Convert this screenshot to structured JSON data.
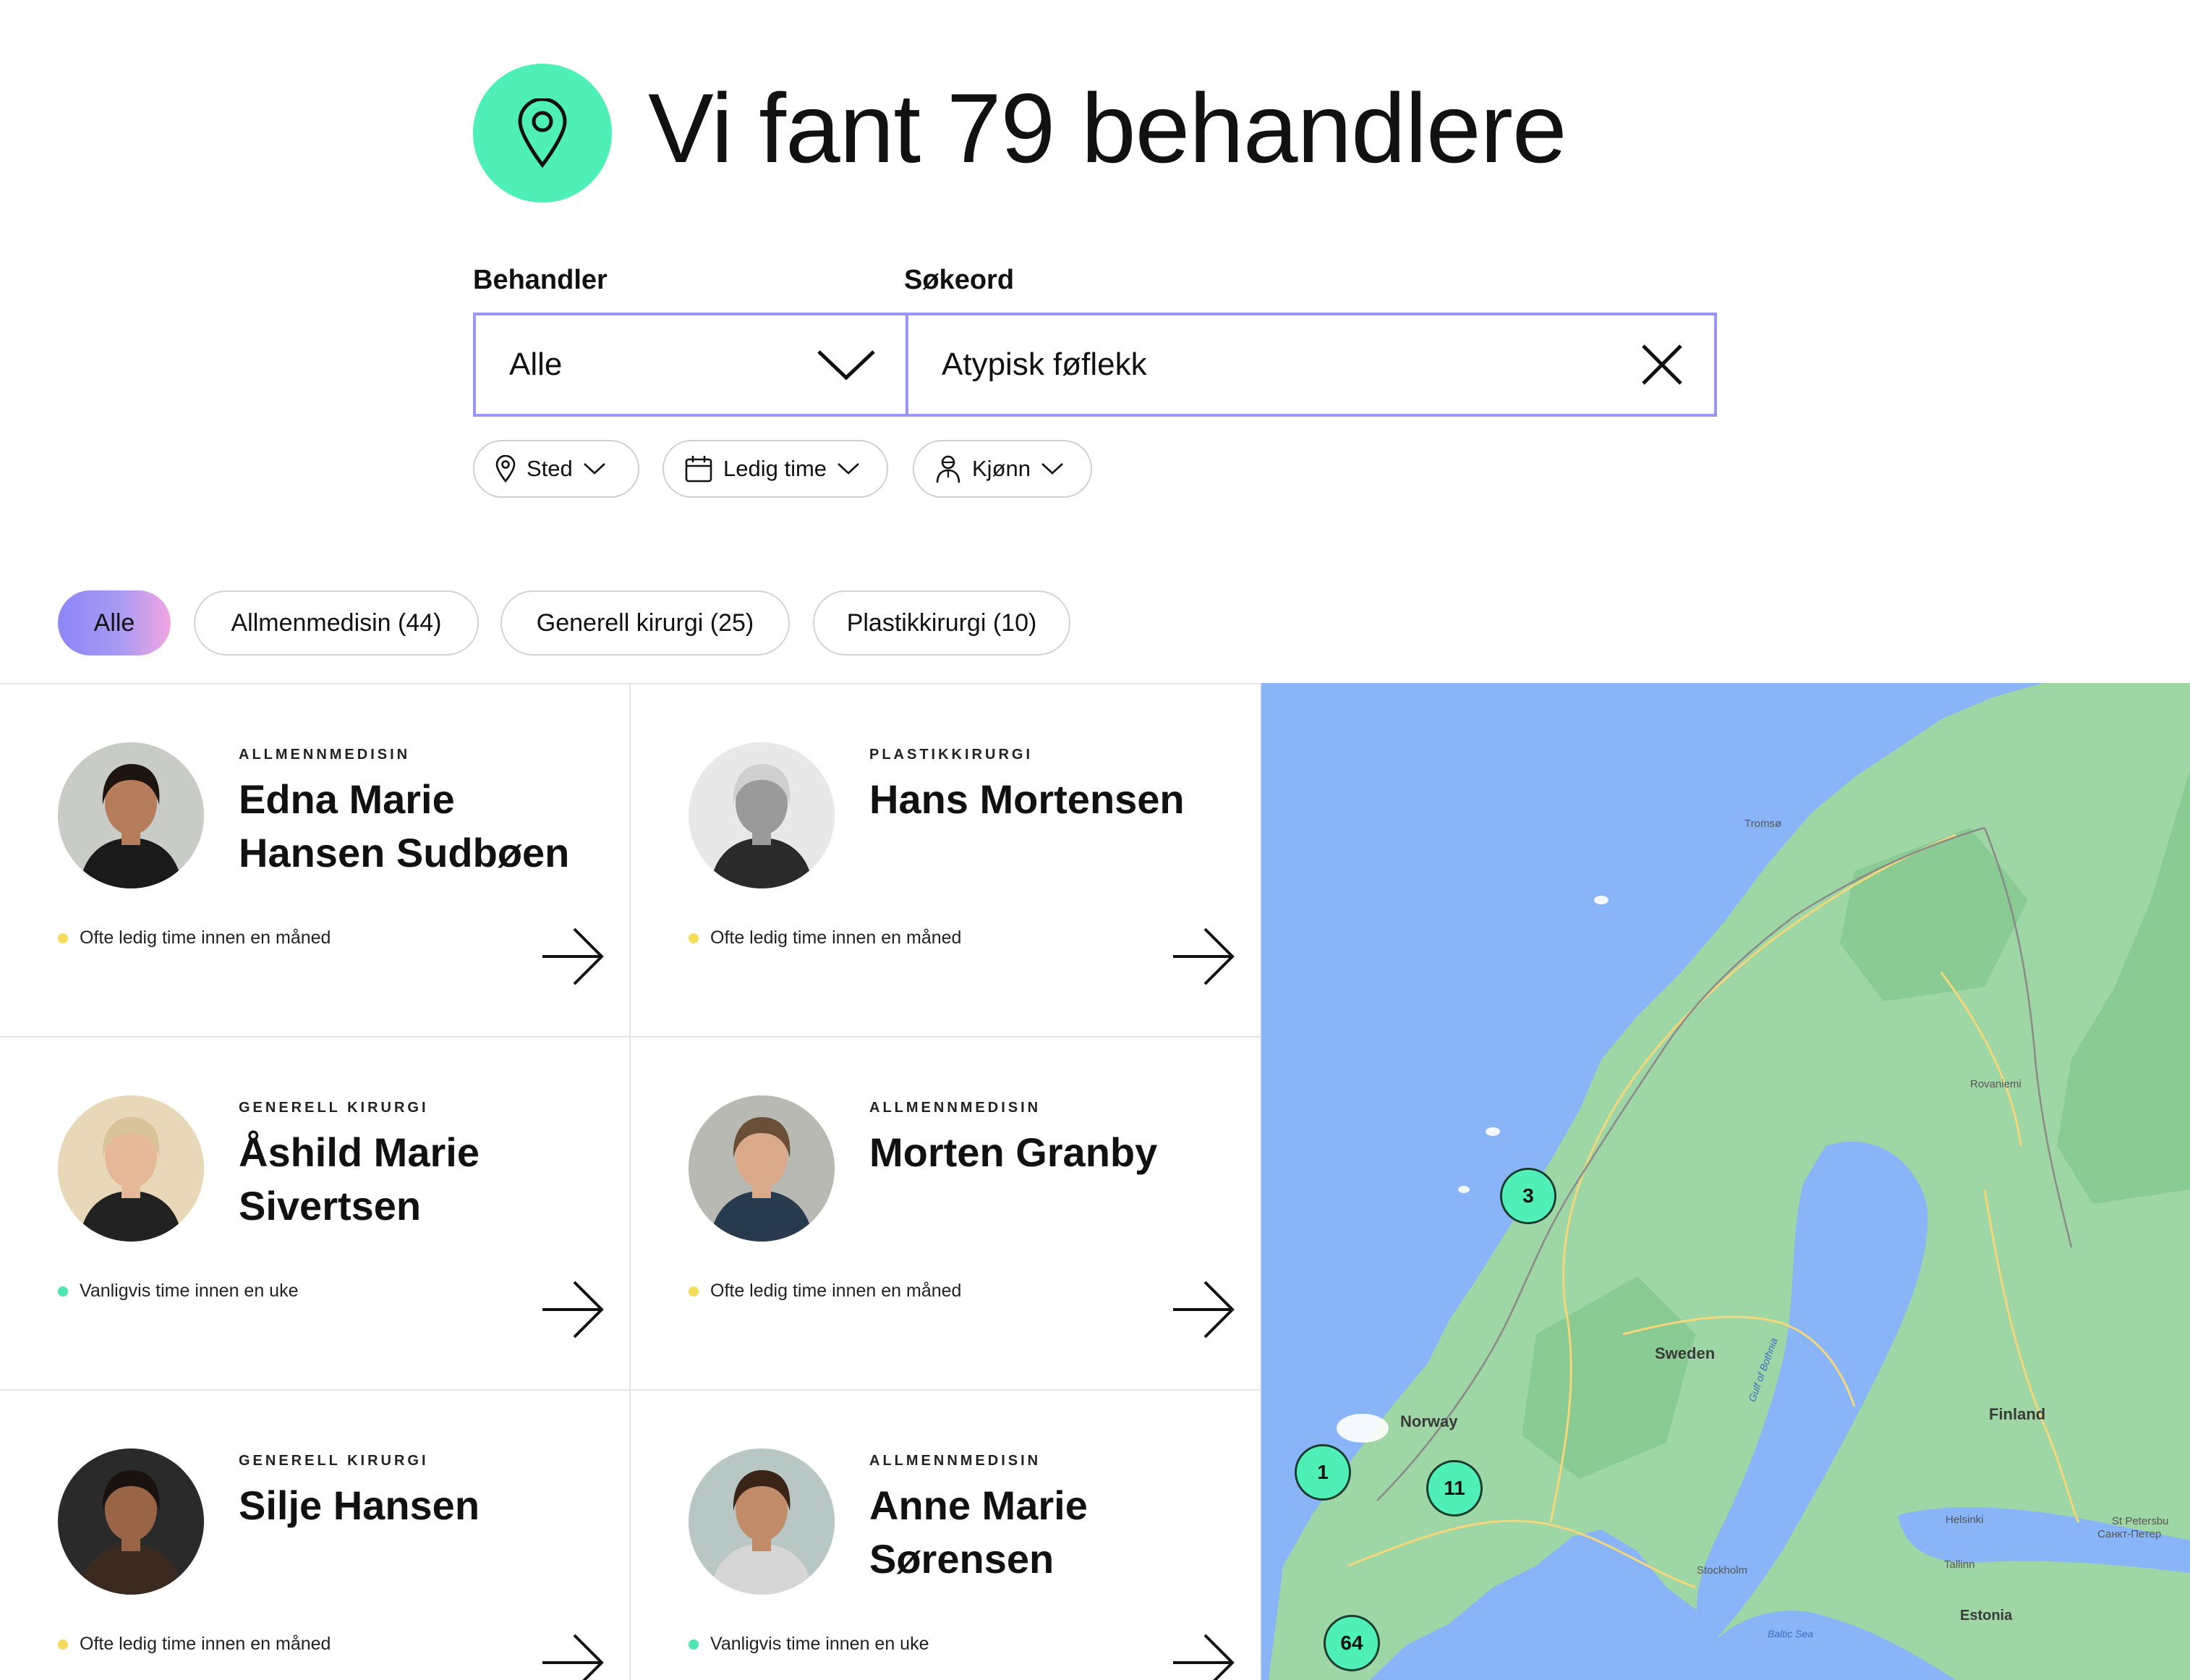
{
  "header": {
    "title": "Vi fant 79 behandlere"
  },
  "search": {
    "behandler_label": "Behandler",
    "behandler_value": "Alle",
    "sokeord_label": "Søkeord",
    "sokeord_value": "Atypisk føflekk"
  },
  "filters": [
    {
      "label": "Sted",
      "icon": "location-pin-icon"
    },
    {
      "label": "Ledig time",
      "icon": "calendar-icon"
    },
    {
      "label": "Kjønn",
      "icon": "person-icon"
    }
  ],
  "tabs": [
    {
      "label": "Alle",
      "active": true
    },
    {
      "label": "Allmenmedisin (44)",
      "active": false
    },
    {
      "label": "Generell kirurgi (25)",
      "active": false
    },
    {
      "label": "Plastikkirurgi (10)",
      "active": false
    }
  ],
  "cards": [
    {
      "specialty": "ALLMENNMEDISIN",
      "name": "Edna Marie Hansen Sudbøen",
      "status": "Ofte ledig time innen en måned",
      "status_color": "#f5dc5a",
      "avatar_bg": "#c9ccc6",
      "skin": "#b57d5c",
      "hair": "#1e1410",
      "shirt": "#1a1a1a"
    },
    {
      "specialty": "PLASTIKKIRURGI",
      "name": "Hans Mortensen",
      "status": "Ofte ledig time innen en måned",
      "status_color": "#f5dc5a",
      "avatar_bg": "#e8e8e8",
      "skin": "#9a9a9a",
      "hair": "#cfcfcf",
      "shirt": "#2a2a2a"
    },
    {
      "specialty": "GENERELL KIRURGI",
      "name": "Åshild Marie Sivertsen",
      "status": "Vanligvis time innen en uke",
      "status_color": "#4ee6b0",
      "avatar_bg": "#e9d8b8",
      "skin": "#e4b898",
      "hair": "#d8c29a",
      "shirt": "#222222"
    },
    {
      "specialty": "ALLMENNMEDISIN",
      "name": "Morten Granby",
      "status": "Ofte ledig time innen en måned",
      "status_color": "#f5dc5a",
      "avatar_bg": "#b9b9b4",
      "skin": "#d9a98a",
      "hair": "#6a4e36",
      "shirt": "#273a4e"
    },
    {
      "specialty": "GENERELL KIRURGI",
      "name": "Silje Hansen",
      "status": "Ofte ledig time innen en måned",
      "status_color": "#f5dc5a",
      "avatar_bg": "#2a2a2a",
      "skin": "#9a6446",
      "hair": "#1a120e",
      "shirt": "#3a2a20"
    },
    {
      "specialty": "ALLMENNMEDISIN",
      "name": "Anne Marie Sørensen",
      "status": "Vanligvis time innen en uke",
      "status_color": "#4ee6b0",
      "avatar_bg": "#b9c7c4",
      "skin": "#c28c6a",
      "hair": "#3a2418",
      "shirt": "#d6d6d6"
    }
  ],
  "map": {
    "clusters": [
      {
        "count": "3"
      },
      {
        "count": "1"
      },
      {
        "count": "11"
      },
      {
        "count": "64"
      }
    ],
    "labels": {
      "sweden": "Sweden",
      "norway": "Norway",
      "finland": "Finland",
      "stockholm": "Stockholm",
      "helsinki": "Helsinki",
      "tallinn": "Tallinn",
      "estonia": "Estonia",
      "rovaniemi": "Rovaniemi",
      "tromso": "Tromsø",
      "stpetersburg": "St Petersbu",
      "stpetersburg_ru": "Санкт-Петер",
      "gulf": "Gulf of Bothnia",
      "baltic": "Baltic Sea"
    }
  }
}
